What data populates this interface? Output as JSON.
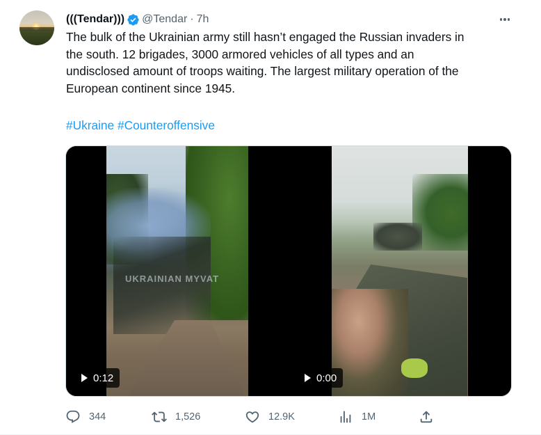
{
  "author": {
    "display_name": "(((Tendar)))",
    "handle": "@Tendar",
    "separator": "·",
    "time": "7h",
    "verified": true,
    "verified_color": "#1d9bf0"
  },
  "tweet": {
    "lines": [
      "The bulk of the Ukrainian army still hasn’t engaged the Russian invaders in",
      "the south. 12 brigades, 3000 armored vehicles of all types and an",
      "undisclosed amount of troops waiting. The largest military operation of the",
      "European continent since 1945."
    ],
    "hashtags": [
      "#Ukraine",
      "#Counteroffensive"
    ]
  },
  "media": {
    "videos": [
      {
        "duration": "0:12",
        "watermark": "UKRAINIAN MYVAT"
      },
      {
        "duration": "0:00"
      }
    ]
  },
  "actions": {
    "replies": "344",
    "retweets": "1,526",
    "likes": "12.9K",
    "views": "1M"
  },
  "colors": {
    "text": "#0f1419",
    "secondary": "#536471",
    "link": "#1d9bf0",
    "border": "#cfd9de"
  },
  "icons": [
    "more-icon",
    "verified-badge-icon",
    "reply-icon",
    "retweet-icon",
    "like-icon",
    "views-icon",
    "share-icon",
    "play-icon"
  ]
}
